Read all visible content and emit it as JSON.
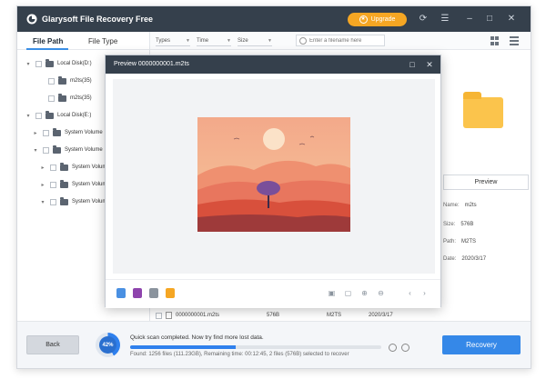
{
  "app": {
    "title": "Glarysoft File Recovery Free",
    "upgrade_label": "Upgrade"
  },
  "colors": {
    "titlebar": "#35404c",
    "accent": "#2f80ed",
    "upgrade": "#f5a623"
  },
  "left_panel": {
    "tabs": [
      {
        "label": "File Path"
      },
      {
        "label": "File Type"
      }
    ],
    "tree": [
      {
        "label": "Local Disk(D:)"
      },
      {
        "label": "m2ts(35)"
      },
      {
        "label": "m2ts(35)"
      },
      {
        "label": "Local Disk(E:)"
      },
      {
        "label": "System Volume"
      },
      {
        "label": "System Volume"
      },
      {
        "label": "System Volume"
      },
      {
        "label": "System Volume"
      },
      {
        "label": "System Volume"
      }
    ]
  },
  "filters": {
    "types": "Types",
    "time": "Time",
    "size": "Size",
    "search_placeholder": "Enter a filename here"
  },
  "preview_dialog": {
    "title": "Preview 0000000001.m2ts"
  },
  "details": {
    "preview_label": "Preview",
    "rows": [
      {
        "label": "Name:",
        "value": "m2ts"
      },
      {
        "label": "Size:",
        "value": "576B"
      },
      {
        "label": "Path:",
        "value": "M2TS"
      },
      {
        "label": "Date:",
        "value": "2020/3/17"
      }
    ]
  },
  "file_list": [
    {
      "name": "0000000001.m2ts",
      "size": "576B",
      "type": "M2TS",
      "date": "2020/3/17"
    }
  ],
  "bottom": {
    "back_label": "Back",
    "progress_label": "42%",
    "progress": 0.42,
    "message": "Quick scan completed. Now try find more lost data.",
    "info": "Found: 1256 files (111.23GB), Remaining time: 00:12:45, 2 files (576B) selected to recover",
    "recovery_label": "Recovery"
  }
}
